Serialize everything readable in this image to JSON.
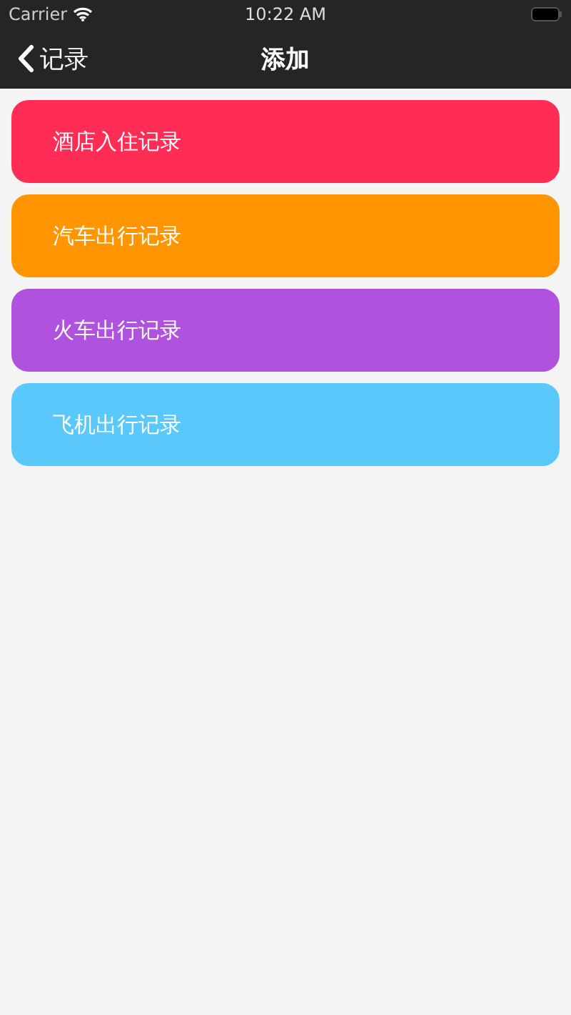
{
  "status_bar": {
    "carrier": "Carrier",
    "time": "10:22 AM"
  },
  "nav_bar": {
    "back_label": "记录",
    "title": "添加"
  },
  "records": [
    {
      "label": "酒店入住记录",
      "color": "#ff2d55"
    },
    {
      "label": "汽车出行记录",
      "color": "#ff9500"
    },
    {
      "label": "火车出行记录",
      "color": "#af52de"
    },
    {
      "label": "飞机出行记录",
      "color": "#5ac8fa"
    }
  ]
}
